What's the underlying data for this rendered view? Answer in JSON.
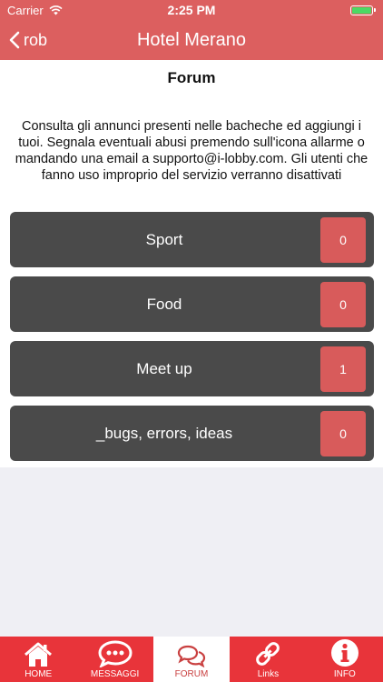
{
  "status": {
    "carrier": "Carrier",
    "time": "2:25 PM"
  },
  "nav": {
    "back_label": "rob",
    "title": "Hotel Merano"
  },
  "page": {
    "title": "Forum",
    "intro": "Consulta gli annunci presenti nelle bacheche ed aggiungi i tuoi. Segnala eventuali abusi premendo sull'icona allarme o mandando una email a supporto@i-lobby.com. Gli utenti che fanno uso improprio del servizio verranno disattivati"
  },
  "forums": [
    {
      "label": "Sport",
      "count": "0"
    },
    {
      "label": "Food",
      "count": "0"
    },
    {
      "label": "Meet up",
      "count": "1"
    },
    {
      "label": "_bugs, errors, ideas",
      "count": "0"
    }
  ],
  "tabs": [
    {
      "label": "HOME",
      "icon": "home-icon"
    },
    {
      "label": "MESSAGGI",
      "icon": "chat-bubble-icon"
    },
    {
      "label": "FORUM",
      "icon": "forum-icon",
      "active": true
    },
    {
      "label": "Links",
      "icon": "link-icon"
    },
    {
      "label": "INFO",
      "icon": "info-icon"
    }
  ],
  "colors": {
    "header": "#dc5f5f",
    "tabbar": "#e8343a",
    "row": "#4a4a4a",
    "badge": "#d85b5b",
    "battery": "#4cd964"
  }
}
